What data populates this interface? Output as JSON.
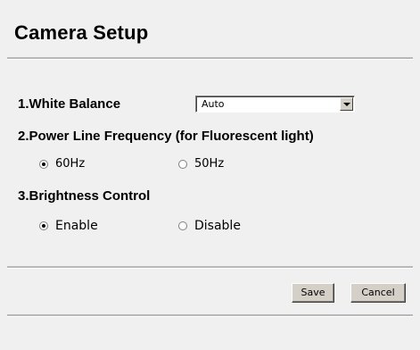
{
  "page": {
    "title": "Camera Setup"
  },
  "white_balance": {
    "label": "1.White Balance",
    "selected": "Auto"
  },
  "power_line": {
    "label": "2.Power Line Frequency (for Fluorescent light)",
    "options": [
      {
        "label": "60Hz",
        "checked": true
      },
      {
        "label": "50Hz",
        "checked": false
      }
    ]
  },
  "brightness": {
    "label": "3.Brightness Control",
    "options": [
      {
        "label": "Enable",
        "checked": true
      },
      {
        "label": "Disable",
        "checked": false
      }
    ]
  },
  "buttons": {
    "save": "Save",
    "cancel": "Cancel"
  },
  "colors": {
    "background": "#f0f0f0",
    "button_face": "#d4d0c8",
    "divider": "#b8b8b8"
  }
}
